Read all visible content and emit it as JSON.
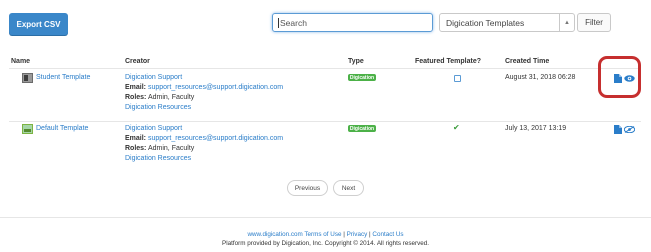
{
  "toolbar": {
    "export_label": "Export CSV",
    "search_placeholder": "Search",
    "template_select_value": "Digication Templates",
    "filter_label": "Filter"
  },
  "table": {
    "headers": [
      "Name",
      "Creator",
      "Type",
      "Featured Template?",
      "Created Time"
    ],
    "rows": [
      {
        "name": "Student Template",
        "creator_name": "Digication Support",
        "email_label": "Email:",
        "email": "support_resources@support.digication.com",
        "roles_label": "Roles:",
        "roles": "Admin, Faculty",
        "resources_link": "Digication Resources",
        "type": "Digication",
        "featured": false,
        "created": "August 31, 2018 06:28"
      },
      {
        "name": "Default Template",
        "creator_name": "Digication Support",
        "email_label": "Email:",
        "email": "support_resources@support.digication.com",
        "roles_label": "Roles:",
        "roles": "Admin, Faculty",
        "resources_link": "Digication Resources",
        "type": "Digication",
        "featured": true,
        "created": "July 13, 2017 13:19"
      }
    ]
  },
  "pagination": {
    "previous_label": "Previous",
    "next_label": "Next"
  },
  "footer": {
    "site_link": "www.digication.com",
    "terms_link": "Terms of Use",
    "sep1": "|",
    "privacy_link": "Privacy",
    "sep2": "|",
    "contact_link": "Contact Us",
    "copyright": "Platform provided by Digication, Inc. Copyright © 2014. All rights reserved."
  },
  "icons": {
    "thumbnail_student": "template-thumbnail-icon",
    "thumbnail_default": "template-thumbnail-icon",
    "checkbox": "checkbox-icon",
    "checkmark": "checkmark-icon",
    "doc": "document-icon",
    "eye": "eye-icon"
  },
  "colors": {
    "accent": "#3a87c9",
    "link": "#2a7dc9",
    "badge": "#4cb148",
    "highlight": "#c62f2f"
  }
}
